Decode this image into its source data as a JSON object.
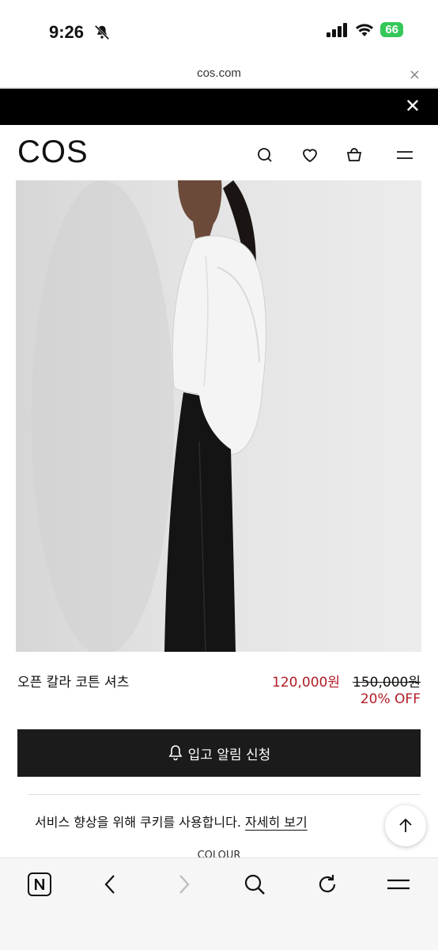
{
  "status_bar": {
    "time": "9:26",
    "battery": "66"
  },
  "browser": {
    "url": "cos.com",
    "url_close_glyph": "×"
  },
  "banner": {
    "close_glyph": "✕"
  },
  "header": {
    "logo": "COS",
    "icons": [
      "search-icon",
      "heart-icon",
      "bag-icon",
      "menu-icon"
    ]
  },
  "product": {
    "name": "오픈 칼라 코튼 셔츠",
    "sale_price": "120,000원",
    "original_price": "150,000원",
    "discount": "20% OFF",
    "notify_label": "입고 알림 신청"
  },
  "cookie_notice": {
    "text": "서비스 향상을 위해 쿠키를 사용합니다.",
    "link": "자세히 보기"
  },
  "section_peek": "COLOUR",
  "colors": {
    "sale_red": "#b11c25",
    "button_dark": "#1b1b1b",
    "battery_green": "#35c759"
  }
}
